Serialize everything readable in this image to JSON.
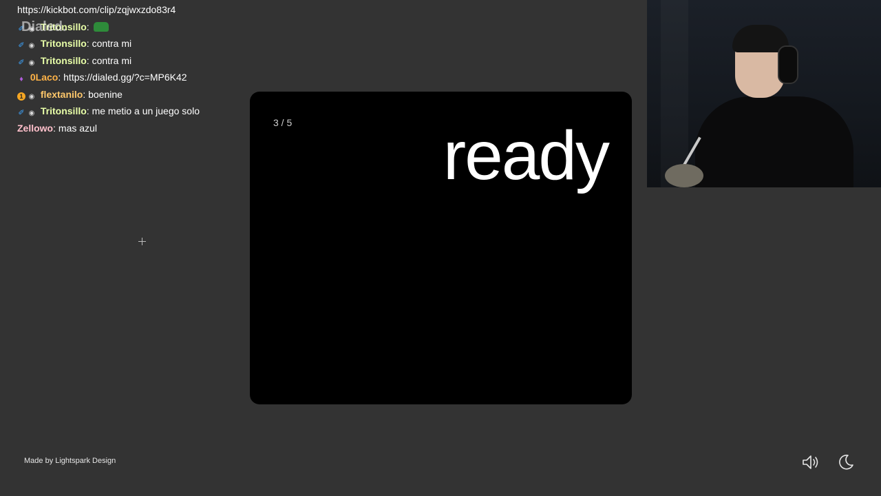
{
  "chat": {
    "url_line": "https://kickbot.com/clip/zqjwxzdo83r4",
    "brand_overlay": "Dialed.",
    "messages": [
      {
        "badges": [
          "mod",
          "sub"
        ],
        "user": "Tritonsillo",
        "text": "",
        "emote": "green-emote",
        "user_class": "triton"
      },
      {
        "badges": [
          "mod",
          "sub"
        ],
        "user": "Tritonsillo",
        "text": "contra mi",
        "user_class": "triton"
      },
      {
        "badges": [
          "mod",
          "sub"
        ],
        "user": "Tritonsillo",
        "text": "contra mi",
        "user_class": "triton"
      },
      {
        "badges": [
          "vip"
        ],
        "user": "0Laco",
        "text": "https://dialed.gg/?c=MP6K42",
        "user_class": "laco"
      },
      {
        "badges": [
          "gift",
          "sub"
        ],
        "user": "flextanilo",
        "text": "boenine",
        "user_class": "flex"
      },
      {
        "badges": [
          "mod",
          "sub"
        ],
        "user": "Tritonsillo",
        "text": "me metio a un juego solo",
        "user_class": "triton"
      },
      {
        "badges": [],
        "user": "Zellowo",
        "text": "mas azul",
        "user_class": "zell"
      }
    ]
  },
  "game": {
    "counter": "3 / 5",
    "prompt": "ready",
    "card_color": "#000000"
  },
  "footer": {
    "credit": "Made by Lightspark Design"
  },
  "icons": {
    "volume": "volume-icon",
    "theme": "moon-icon"
  },
  "colors": {
    "background": "#333333",
    "mod_badge": "#3ea6ff",
    "vip_badge": "#b05ddc"
  }
}
